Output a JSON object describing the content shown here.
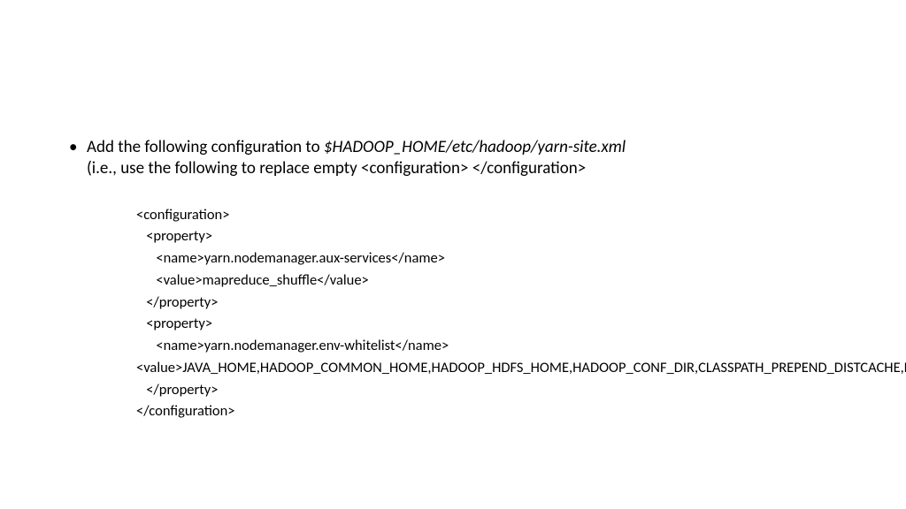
{
  "bullet": {
    "marker": "•",
    "text_pre": "Add the following configuration to ",
    "path": "$HADOOP_HOME/etc/hadoop/yarn-site.xml",
    "text_post": "(i.e., use the following to replace empty <configuration> </configuration>"
  },
  "code": {
    "l1": "<configuration>",
    "l2": "   <property>",
    "l3": "      <name>yarn.nodemanager.aux-services</name>",
    "l4": "      <value>mapreduce_shuffle</value>",
    "l5": "   </property>",
    "l6": "   <property>",
    "l7": "      <name>yarn.nodemanager.env-whitelist</name>",
    "l8": "",
    "l9": "<value>JAVA_HOME,HADOOP_COMMON_HOME,HADOOP_HDFS_HOME,HADOOP_CONF_DIR,CLASSPATH_PREPEND_DISTCACHE,HADOOP_YARN_HOME,HADOOP_MAPRED_HOME</value>",
    "l10": "   </property>",
    "l11": "</configuration>"
  }
}
